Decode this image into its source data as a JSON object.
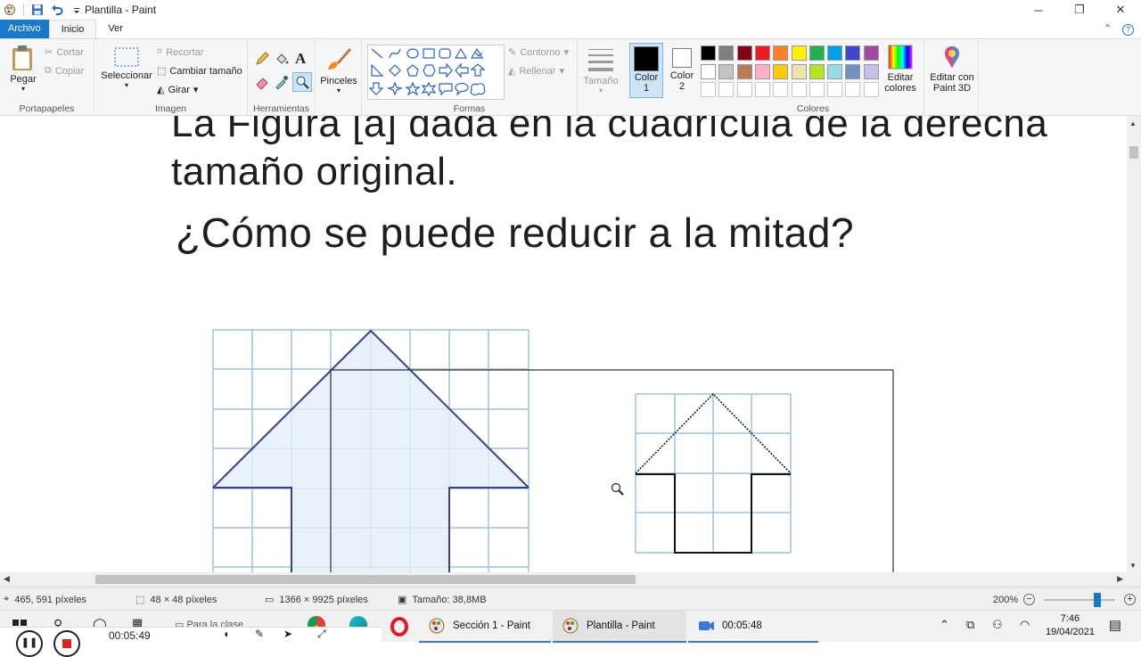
{
  "window": {
    "title": "Plantilla - Paint",
    "controls": [
      "minimize",
      "maximize",
      "close"
    ]
  },
  "tabs": [
    {
      "label": "Archivo"
    },
    {
      "label": "Inicio"
    },
    {
      "label": "Ver"
    }
  ],
  "ribbon": {
    "clipboard": {
      "paste": "Pegar",
      "cut": "Cortar",
      "copy": "Copiar",
      "group": "Portapapeles"
    },
    "image": {
      "select": "Seleccionar",
      "crop": "Recortar",
      "resize": "Cambiar tamaño",
      "rotate": "Girar",
      "group": "Imagen"
    },
    "tools": {
      "group": "Herramientas",
      "text_tool": "A"
    },
    "brushes": {
      "label": "Pinceles"
    },
    "shapes": {
      "outline": "Contorno",
      "fill": "Rellenar",
      "group": "Formas"
    },
    "size": {
      "label": "Tamaño"
    },
    "color1": {
      "label": "Color",
      "sub": "1",
      "value": "#000000"
    },
    "color2": {
      "label": "Color",
      "sub": "2",
      "value": "#ffffff"
    },
    "colors": {
      "group": "Colores",
      "row1": [
        "#000000",
        "#7f7f7f",
        "#880015",
        "#ed1c24",
        "#ff7f27",
        "#fff200",
        "#22b14c",
        "#00a2e8",
        "#3f48cc",
        "#a349a4"
      ],
      "row2": [
        "#ffffff",
        "#c3c3c3",
        "#b97a57",
        "#ffaec9",
        "#ffc90e",
        "#efe4b0",
        "#b5e61d",
        "#99d9ea",
        "#7092be",
        "#c8bfe7"
      ],
      "row3": [
        "#ffffff",
        "#ffffff",
        "#ffffff",
        "#ffffff",
        "#ffffff",
        "#ffffff",
        "#ffffff",
        "#ffffff",
        "#ffffff",
        "#ffffff"
      ]
    },
    "edit_colors": {
      "line1": "Editar",
      "line2": "colores"
    },
    "paint3d": {
      "line1": "Editar con",
      "line2": "Paint 3D"
    }
  },
  "canvas": {
    "line1": "La Figura [a] dada en la cuadrícula de la derecha",
    "line2": "tamaño original.",
    "line3": "¿Cómo se puede reducir a la mitad?"
  },
  "status": {
    "cursor_pos": "465, 591 píxeles",
    "selection_size": "48 × 48 píxeles",
    "image_size": "1366 × 9925 píxeles",
    "file_size": "Tamaño: 38,8MB",
    "zoom": "200%",
    "zoom_level": 0.75
  },
  "taskbar": {
    "search_hint": "Para la clase",
    "timer_left": "00:05:49",
    "items": [
      {
        "label": "Sección 1 - Paint"
      },
      {
        "label": "Plantilla - Paint"
      },
      {
        "label": "00:05:48"
      }
    ],
    "time": "7:46",
    "date": "19/04/2021"
  }
}
